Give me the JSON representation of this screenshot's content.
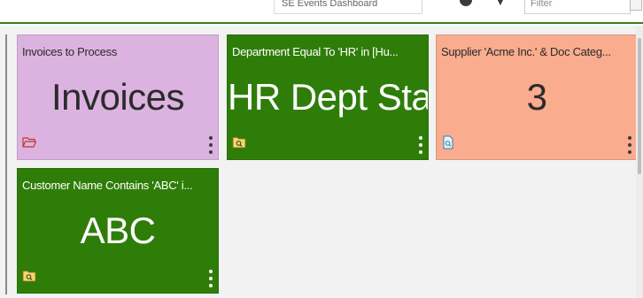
{
  "header": {
    "dashboard_name": "SE Events Dashboard",
    "filter_placeholder": "Filter"
  },
  "tiles": [
    {
      "title": "Invoices to Process",
      "value": "Invoices",
      "color": "#dcb3e0",
      "icon": "folder-open-icon"
    },
    {
      "title": "Department Equal To 'HR' in [Hu...",
      "value": "HR Dept Staff",
      "color": "#2f7d09",
      "icon": "folder-search-icon"
    },
    {
      "title": "Supplier 'Acme Inc.' & Doc Categ...",
      "value": "3",
      "color": "#f9ac8e",
      "icon": "document-search-icon"
    },
    {
      "title": "Customer Name Contains 'ABC' i...",
      "value": "ABC",
      "color": "#2f7d09",
      "icon": "folder-search-icon"
    }
  ]
}
